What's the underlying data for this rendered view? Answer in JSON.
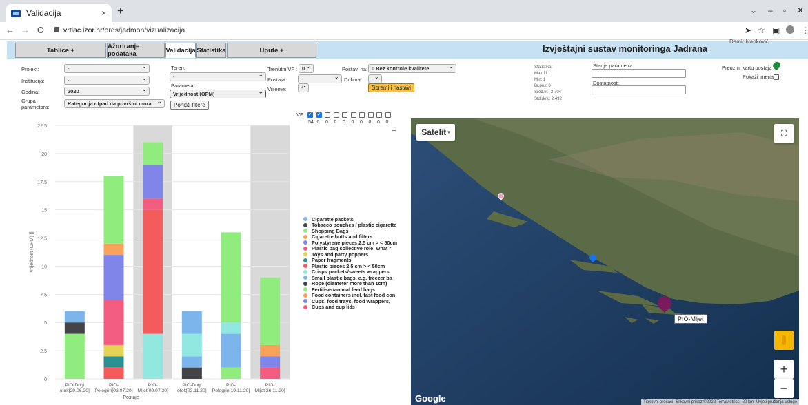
{
  "browser": {
    "tab_title": "Validacija",
    "tab_close": "×",
    "new_tab": "+",
    "url_domain": "vrtlac.izor.hr",
    "url_path": "/ords/jadmon/vizualizacija",
    "back": "←",
    "forward": "→",
    "reload": "C",
    "win_chevron": "⌄",
    "win_min": "–",
    "win_max": "▫",
    "win_close": "✕",
    "share_icon": "➤",
    "star_icon": "☆",
    "ext_icon": "▣",
    "menu_icon": "⋮"
  },
  "app": {
    "title": "Izvještajni sustav monitoringa Jadrana",
    "user": "Damir Ivanković",
    "tabs": [
      {
        "label": "Tablice    +"
      },
      {
        "label": "Ažuriranje podataka"
      },
      {
        "label": "Validacija"
      },
      {
        "label": "Statistika"
      },
      {
        "label": "Upute    +"
      }
    ]
  },
  "filters": {
    "projekt_label": "Projekt:",
    "projekt_value": "-",
    "institucija_label": "Institucija:",
    "institucija_value": "-",
    "godina_label": "Godina:",
    "godina_value": "2020",
    "grupa_label": "Grupa parametara:",
    "grupa_value": "Kategorija otpad na površini mora",
    "teren_label": "Teren:",
    "teren_value": "-",
    "parametar_label": "Parametar:",
    "parametar_value": "Vrijednost (OPM)",
    "reset_button": "Poništi filtere",
    "trenutni_vf_label": "Trenutni VF :",
    "trenutni_vf_value": "0",
    "postaja_label": "Postaja:",
    "postaja_value": "-",
    "vrijeme_label": "Vrijeme:",
    "vrijeme_value": "-",
    "postavi_label": "Postavi na:",
    "postavi_value": "0 Bez kontrole kvalitete",
    "dubina_label": "Dubina:",
    "dubina_value": "-",
    "save_button": "Spremi i nastavi"
  },
  "stats": {
    "title": "Statistika:",
    "max": "Max:11",
    "min": "Min: 1",
    "brpos": "Br.pos: 6",
    "sred": "Sred.vr.: 2.704",
    "stddev": "Std.dev.: 2.492",
    "stanje_label": "Stanje parametra:",
    "dostatnost_label": "Dostatnost:",
    "preuzmi_label": "Preuzmi kartu postaja",
    "pokazi_label": "Pokaži imena:"
  },
  "vf": {
    "label": "VF:",
    "checked": [
      true,
      true,
      false,
      false,
      false,
      false,
      false,
      false,
      false,
      false
    ],
    "counts": [
      "54",
      "0",
      "0",
      "0",
      "0",
      "0",
      "0",
      "0",
      "0",
      "0"
    ]
  },
  "chart_data": {
    "type": "bar",
    "stacked": true,
    "ylabel": "Vrijednost (OPM) []",
    "xlabel": "Postaje",
    "ylim": [
      0,
      22.5
    ],
    "yticks": [
      "0",
      "2.5",
      "5",
      "7.5",
      "10",
      "12.5",
      "15",
      "17.5",
      "20",
      "22.5"
    ],
    "categories": [
      [
        "PIO-Dugi",
        "otok[29.06.20]"
      ],
      [
        "PIO-",
        "Pelegrin[02.07.20]"
      ],
      [
        "PIO-",
        "Mljet[09.07.20]"
      ],
      [
        "PIO-Dugi",
        "otok[02.11.20]"
      ],
      [
        "PIO-",
        "Pelegrin[19.11.20]"
      ],
      [
        "PIO-",
        "Mljet[26.11.20]"
      ]
    ],
    "highlighted": [
      false,
      false,
      true,
      false,
      false,
      true
    ],
    "series": [
      {
        "name": "Cigarette packets",
        "color": "#7cb5ec",
        "values": [
          1,
          0,
          0,
          0,
          0,
          0
        ]
      },
      {
        "name": "Tobacco pouches / plastic cigarette",
        "color": "#434348",
        "values": [
          1,
          0,
          0,
          0,
          0,
          0
        ]
      },
      {
        "name": "Shopping Bags",
        "color": "#90ed7d",
        "values": [
          4,
          0,
          0,
          0,
          0,
          0
        ]
      },
      {
        "name": "Cigarette butts and filters",
        "color": "#f7a35c",
        "values": [
          0,
          0,
          0,
          0,
          0,
          0
        ]
      },
      {
        "name": "Polystyrene pieces 2.5 cm > < 50cm",
        "color": "#8085e9",
        "values": [
          0,
          0,
          0,
          0,
          0,
          0
        ]
      },
      {
        "name": "Plastic bag collective role; what r",
        "color": "#f15c80",
        "values": [
          0,
          0,
          0,
          0,
          0,
          0
        ]
      },
      {
        "name": "Toys and party poppers",
        "color": "#e4d354",
        "values": [
          0,
          0,
          0,
          0,
          0,
          0
        ]
      },
      {
        "name": "Paper fragments",
        "color": "#2b908f",
        "values": [
          0,
          0,
          0,
          0,
          0,
          0
        ]
      },
      {
        "name": "Plastic pieces 2.5 cm > < 50cm",
        "color": "#f45b5b",
        "values": [
          0,
          0,
          0,
          0,
          0,
          0
        ]
      },
      {
        "name": "Crisps packets/sweets wrappers",
        "color": "#91e8e1",
        "values": [
          0,
          0,
          0,
          0,
          0,
          0
        ]
      },
      {
        "name": "Small plastic bags, e.g. freezer ba",
        "color": "#7cb5ec",
        "values": [
          0,
          0,
          0,
          0,
          0,
          0
        ]
      },
      {
        "name": "Rope (diameter more than 1cm)",
        "color": "#434348",
        "values": [
          0,
          0,
          0,
          0,
          0,
          0
        ]
      },
      {
        "name": "Fertiliser/animal feed bags",
        "color": "#90ed7d",
        "values": [
          0,
          0,
          0,
          0,
          0,
          0
        ]
      },
      {
        "name": "Food containers incl. fast food con",
        "color": "#f7a35c",
        "values": [
          0,
          0,
          0,
          0,
          0,
          0
        ]
      },
      {
        "name": "Cups, food trays, food wrappers,",
        "color": "#8085e9",
        "values": [
          0,
          0,
          0,
          0,
          0,
          0
        ]
      },
      {
        "name": "Cups and cup lids",
        "color": "#f15c80",
        "values": [
          0,
          0,
          0,
          0,
          0,
          0
        ]
      }
    ],
    "stacks": [
      [
        {
          "s": 2,
          "v": 4
        },
        {
          "s": 1,
          "v": 1
        },
        {
          "s": 0,
          "v": 1
        }
      ],
      [
        {
          "s": 8,
          "v": 1
        },
        {
          "s": 7,
          "v": 1
        },
        {
          "s": 6,
          "v": 1
        },
        {
          "s": 5,
          "v": 4
        },
        {
          "s": 4,
          "v": 4
        },
        {
          "s": 3,
          "v": 1
        },
        {
          "s": 2,
          "v": 6
        }
      ],
      [
        {
          "s": 9,
          "v": 4
        },
        {
          "s": 8,
          "v": 11
        },
        {
          "s": 5,
          "v": 1
        },
        {
          "s": 4,
          "v": 3
        },
        {
          "s": 2,
          "v": 2
        }
      ],
      [
        {
          "s": 11,
          "v": 1
        },
        {
          "s": 10,
          "v": 1
        },
        {
          "s": 9,
          "v": 2
        },
        {
          "s": 0,
          "v": 2
        }
      ],
      [
        {
          "s": 12,
          "v": 1
        },
        {
          "s": 10,
          "v": 3
        },
        {
          "s": 9,
          "v": 1
        },
        {
          "s": 2,
          "v": 8
        }
      ],
      [
        {
          "s": 15,
          "v": 1
        },
        {
          "s": 14,
          "v": 1
        },
        {
          "s": 13,
          "v": 1
        },
        {
          "s": 12,
          "v": 6
        }
      ]
    ]
  },
  "map": {
    "type_button": "Satelit",
    "fullscreen_icon": "⛶",
    "zoom_in": "+",
    "zoom_out": "−",
    "pegman_icon": "pegman",
    "tooltip": "PIO-Mljet",
    "logo": "Google",
    "footer": [
      "Tipkovni prečaci",
      "Slikovni prikaz ©2022 TerraMetrics",
      "20 km",
      "Uvjeti pružanja usluge"
    ]
  }
}
